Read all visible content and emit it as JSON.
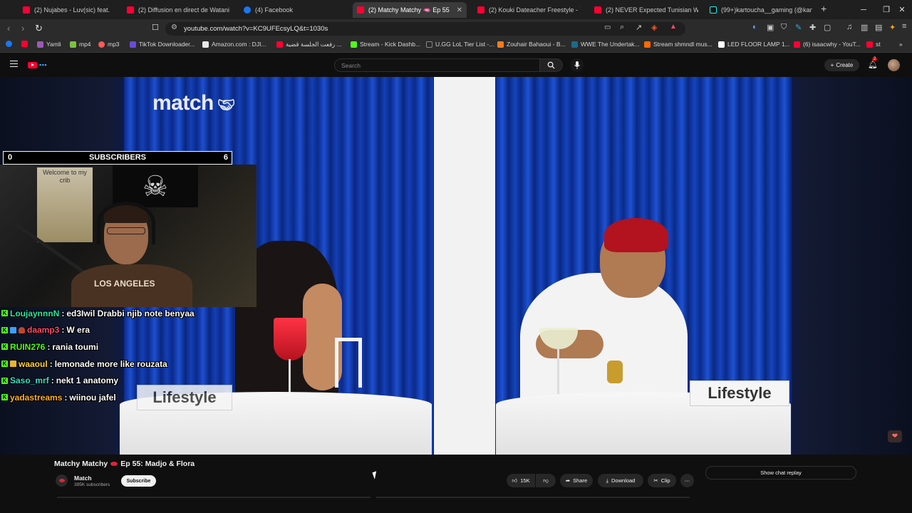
{
  "browser": {
    "tabs": [
      {
        "label": "(2) Nujabes - Luv(sic) feat.Shing0",
        "favicon": "youtube-icon"
      },
      {
        "label": "(2) Diffusion en direct de Watania2 E",
        "favicon": "youtube-icon"
      },
      {
        "label": "(4) Facebook",
        "favicon": "facebook-icon"
      },
      {
        "label": "(2) Matchy Matchy 🫦 Ep 55",
        "favicon": "youtube-icon",
        "active": true
      },
      {
        "label": "(2) Kouki Dateacher Freestyle - YouT",
        "favicon": "youtube-icon"
      },
      {
        "label": "(2) NEVER Expected Tunisian Woman",
        "favicon": "youtube-icon"
      },
      {
        "label": "(99+)kartoucha__gaming (@kartouc",
        "favicon": "tiktok-icon"
      }
    ],
    "url": "youtube.com/watch?v=KC9UFEcsyLQ&t=1030s",
    "bookmarks": [
      "Yamli",
      "mp4",
      "mp3",
      "TikTok Downloader...",
      "Amazon.com : DJI...",
      "رفعت الجلسة قضية ...",
      "Stream - Kick Dashb...",
      "U.GG LoL Tier List -...",
      "Zouhair Bahaoui - B...",
      "WWE The Undertak...",
      "Stream shmndl mus...",
      "LED FLOOR LAMP 1...",
      "(6) isaacwhy - YouT...",
      "st"
    ]
  },
  "youtube": {
    "search_placeholder": "Search",
    "create_label": "Create",
    "notification_count": "2"
  },
  "video": {
    "brand_logo": "match",
    "sign_left": "Lifestyle",
    "sign_right": "Lifestyle"
  },
  "overlay": {
    "subs_left": "0",
    "subs_label": "SUBSCRIBERS",
    "subs_right": "6",
    "poster_text": "Welcome to my crib",
    "shirt_text": "LOS ANGELES"
  },
  "chat": [
    {
      "user": "LoujaynnnN",
      "user_color": "#2ee6a0",
      "message": "ed3Iwil Drabbi njib note benyaa"
    },
    {
      "user": "daamp3",
      "user_color": "#ff4d6d",
      "message": "W era"
    },
    {
      "user": "RUIN276",
      "user_color": "#53fc18",
      "message": "rania toumi"
    },
    {
      "user": "waaoul",
      "user_color": "#ffd23a",
      "message": "lemonade more like rouzata"
    },
    {
      "user": "Saso_mrf",
      "user_color": "#35e0c8",
      "message": "nekt 1 anatomy"
    },
    {
      "user": "yadastreams",
      "user_color": "#ffb020",
      "message": "wiinou jafel"
    }
  ],
  "below": {
    "title_part1": "Matchy Matchy",
    "title_part2": "Ep 55: Madjo & Flora",
    "channel_name": "Match",
    "channel_subs": "395K subscribers",
    "subscribe_label": "Subscribe",
    "likes": "15K",
    "share_label": "Share",
    "download_label": "Download",
    "clip_label": "Clip",
    "chat_replay_label": "Show chat replay"
  },
  "colors": {
    "accent_red": "#ff0033",
    "kick_green": "#53fc18",
    "bg": "#0f0f0f"
  }
}
